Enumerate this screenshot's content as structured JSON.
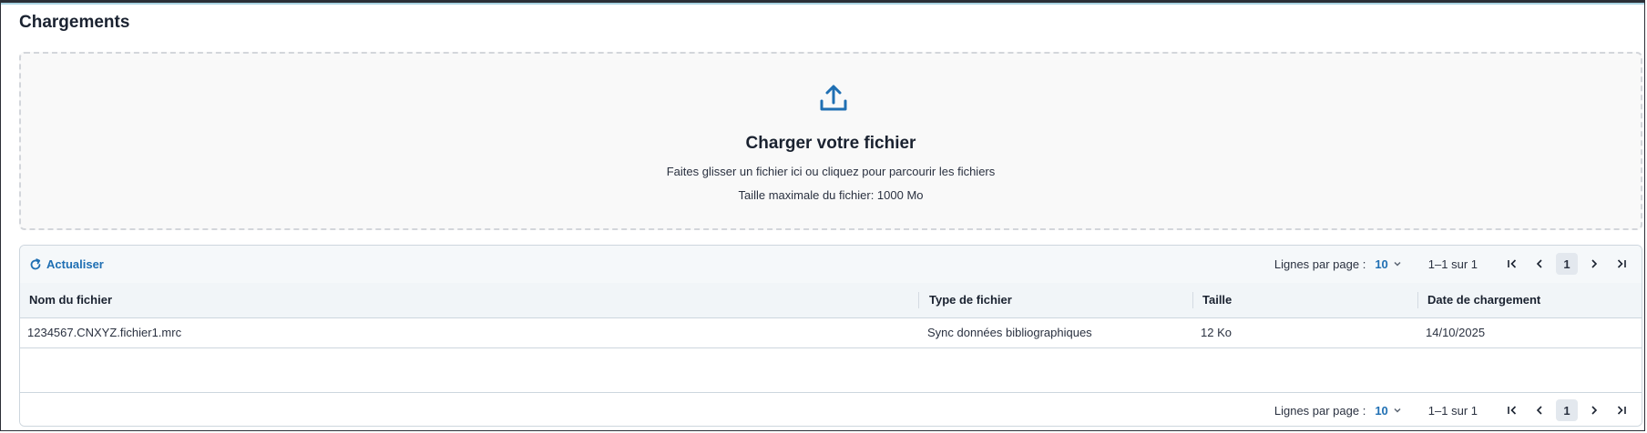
{
  "page": {
    "title": "Chargements"
  },
  "upload": {
    "title": "Charger votre fichier",
    "instructions": "Faites glisser un fichier ici ou cliquez pour parcourir les fichiers",
    "max_size": "Taille maximale du fichier: 1000 Mo",
    "icon": "upload-icon"
  },
  "toolbar": {
    "refresh_label": "Actualiser",
    "refresh_icon": "refresh-icon"
  },
  "pagination": {
    "rows_per_page_label": "Lignes par page :",
    "rows_per_page_value": "10",
    "range": "1–1 sur 1",
    "current_page": "1"
  },
  "table": {
    "columns": [
      "Nom du fichier",
      "Type de fichier",
      "Taille",
      "Date de chargement"
    ],
    "rows": [
      [
        "1234567.CNXYZ.fichier1.mrc",
        "Sync données bibliographiques",
        "12 Ko",
        "14/10/2025"
      ]
    ]
  },
  "colors": {
    "accent": "#1f6fb3",
    "border": "#cdd6de"
  }
}
